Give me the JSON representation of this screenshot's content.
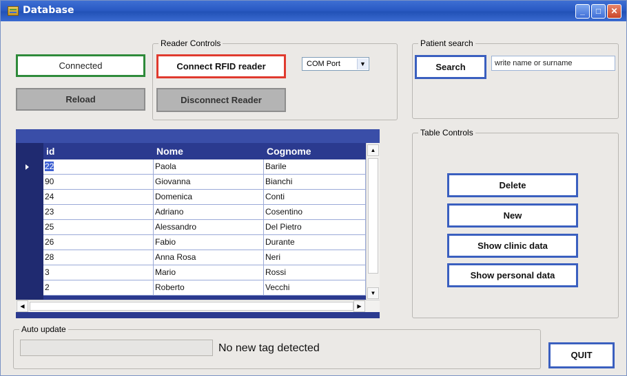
{
  "window": {
    "title": "Database"
  },
  "left_controls": {
    "connected_label": "Connected",
    "reload_label": "Reload"
  },
  "reader_controls": {
    "group_label": "Reader Controls",
    "connect_label": "Connect RFID reader",
    "disconnect_label": "Disconnect Reader",
    "com_port": "COM Port"
  },
  "patient_search": {
    "group_label": "Patient search",
    "search_label": "Search",
    "input_value": "write name or surname"
  },
  "table": {
    "columns": [
      "id",
      "Nome",
      "Cognome"
    ],
    "selected_row": 0,
    "rows": [
      [
        "22",
        "Paola",
        "Barile"
      ],
      [
        "90",
        "Giovanna",
        "Bianchi"
      ],
      [
        "24",
        "Domenica",
        "Conti"
      ],
      [
        "23",
        "Adriano",
        "Cosentino"
      ],
      [
        "25",
        "Alessandro",
        "Del Pietro"
      ],
      [
        "26",
        "Fabio",
        "Durante"
      ],
      [
        "28",
        "Anna Rosa",
        "Neri"
      ],
      [
        "3",
        "Mario",
        "Rossi"
      ],
      [
        "2",
        "Roberto",
        "Vecchi"
      ]
    ]
  },
  "table_controls": {
    "group_label": "Table Controls",
    "delete_label": "Delete",
    "new_label": "New",
    "show_clinic_label": "Show clinic data",
    "show_personal_label": "Show personal data"
  },
  "auto_update": {
    "group_label": "Auto update",
    "status_text": "No new tag detected"
  },
  "quit_label": "QUIT",
  "colors": {
    "accent": "#3a5fbf",
    "connected": "#2e8a3a",
    "connect_reader": "#e03a2e",
    "grid_header": "#2b3a8f"
  }
}
